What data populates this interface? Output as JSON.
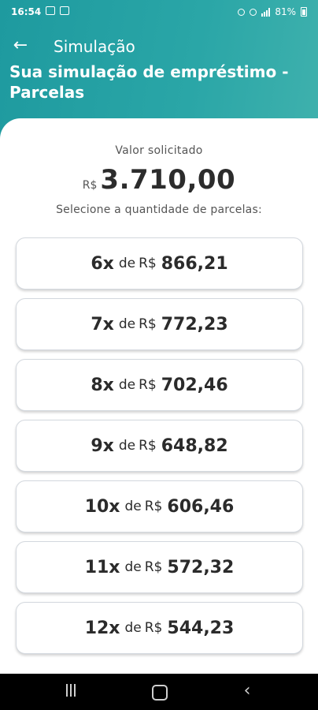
{
  "status_bar": {
    "time": "16:54",
    "battery": "81%"
  },
  "header": {
    "nav_title": "Simulação",
    "title": "Sua simulação de empréstimo - Parcelas"
  },
  "summary": {
    "label": "Valor solicitado",
    "currency": "R$",
    "amount": "3.710,00",
    "instruction": "Selecione a quantidade de parcelas:"
  },
  "options": [
    {
      "count": "6x",
      "de": "de",
      "currency": "R$",
      "value": "866,21"
    },
    {
      "count": "7x",
      "de": "de",
      "currency": "R$",
      "value": "772,23"
    },
    {
      "count": "8x",
      "de": "de",
      "currency": "R$",
      "value": "702,46"
    },
    {
      "count": "9x",
      "de": "de",
      "currency": "R$",
      "value": "648,82"
    },
    {
      "count": "10x",
      "de": "de",
      "currency": "R$",
      "value": "606,46"
    },
    {
      "count": "11x",
      "de": "de",
      "currency": "R$",
      "value": "572,32"
    },
    {
      "count": "12x",
      "de": "de",
      "currency": "R$",
      "value": "544,23"
    }
  ],
  "colors": {
    "header_teal": "#1e9a9f",
    "card_border": "#d3d8de",
    "text_dark": "#2b2b2b"
  },
  "icons": {
    "back": "arrow-left-icon",
    "nav_recents": "recents-icon",
    "nav_home": "home-icon",
    "nav_back": "chevron-left-icon"
  }
}
